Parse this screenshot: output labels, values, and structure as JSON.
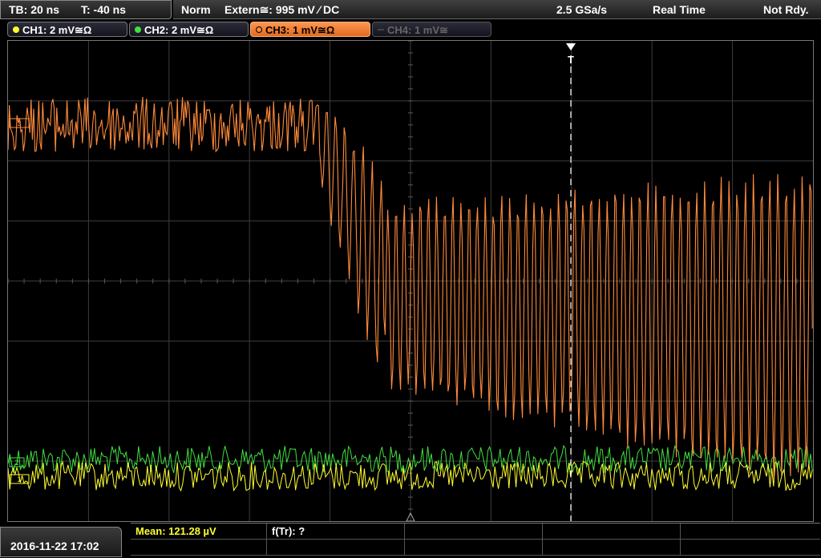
{
  "timebase": {
    "tb_label": "TB: 20 ns",
    "t_label": "T: -40 ns"
  },
  "trigger": {
    "mode": "Norm",
    "source": "Extern≅: 995 mV ⁄ DC",
    "sample_rate": "2.5 GSa/s",
    "acq_mode": "Real Time",
    "status": "Not Rdy."
  },
  "channels": [
    {
      "label": "CH1: 2 mV≅Ω",
      "color": "#ffff30",
      "state": "on"
    },
    {
      "label": "CH2: 2 mV≅Ω",
      "color": "#40e040",
      "state": "on"
    },
    {
      "label": "CH3: 1 mV≅Ω",
      "color": "#ff8a3a",
      "state": "active"
    },
    {
      "label": "CH4: 1 mV≅",
      "color": "#666666",
      "state": "off"
    }
  ],
  "markers": {
    "trigger_time": "T",
    "ch1": "1",
    "ch2": "2",
    "ch3": "3"
  },
  "footer": {
    "datetime": "2016-11-22 17:02"
  },
  "measurements": {
    "mean": "Mean: 121.28 µV",
    "ftr": "f(Tr): ?"
  },
  "colors": {
    "ch1": "#ffff30",
    "ch2": "#40e040",
    "ch3": "#ff8a3a",
    "grid": "#444444",
    "cursor": "#ffffff"
  }
}
